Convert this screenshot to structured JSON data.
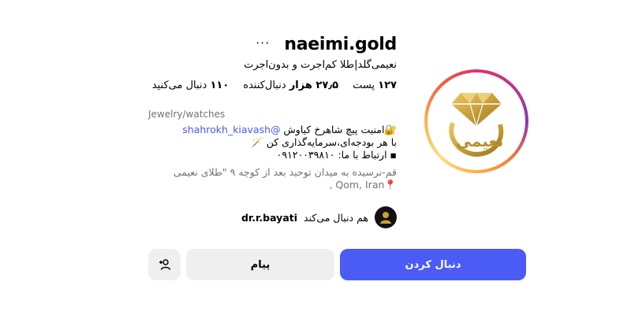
{
  "profile": {
    "username": "naeimi.gold",
    "more_label": "···",
    "full_name": "نعیمی‌گلد|طلا کم‌اجرت و بدون‌اجرت",
    "stats": {
      "posts_count": "۱۲۷",
      "posts_label": "پست",
      "followers_count": "۲۷٫۵ هزار",
      "followers_label": "دنبال‌کننده",
      "following_count": "۱۱۰",
      "following_label": "دنبال می‌کنید"
    },
    "category": "Jewelry/watches",
    "bio": {
      "line1_text": "🔐امنیت پیچ شاهرخ کیاوش ",
      "line1_mention": "@shahrokh_kiavash",
      "line2": "با هر بودجه‌ای،سرمایه‌گذاری کن 🪄",
      "line3": "▪︎ ارتباط با ما: ۰۹۱۲۰۰۳۹۸۱۰"
    },
    "address": {
      "line1": "قم-نرسیده به میدان توحید بعد از کوچه ۹ \"طلای نعیمی",
      "line2": "📍Qom, Iran ,"
    },
    "followed_by": {
      "prefix": "هم دنبال می‌کند",
      "username": "dr.r.bayati"
    },
    "avatar_text": "نعیمی"
  },
  "actions": {
    "follow_label": "دنبال کردن",
    "message_label": "پیام",
    "suggest_icon": "add-person-icon"
  },
  "colors": {
    "accent": "#4a5cf5",
    "gold": "#c9a13a",
    "mention": "#4a5ae8"
  }
}
